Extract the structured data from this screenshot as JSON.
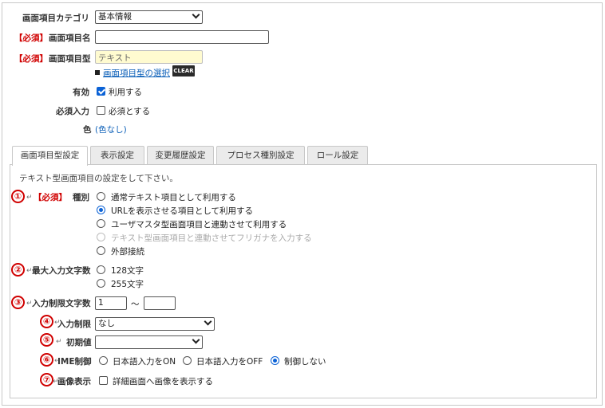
{
  "form": {
    "category_label": "画面項目カテゴリ",
    "category_value": "基本情報",
    "required_tag": "【必須】",
    "name_label": "画面項目名",
    "name_value": "",
    "type_label": "画面項目型",
    "type_value": "テキスト",
    "type_select_link": "画面項目型の選択",
    "clear_button": "CLEAR",
    "enabled_label": "有効",
    "enabled_checkbox_label": "利用する",
    "enabled_checked": true,
    "required_input_label": "必須入力",
    "required_checkbox_label": "必須とする",
    "required_checked": false,
    "color_label": "色",
    "color_value": "(色なし)"
  },
  "tabs": [
    {
      "label": "画面項目型設定",
      "active": true
    },
    {
      "label": "表示設定",
      "active": false
    },
    {
      "label": "変更履歴設定",
      "active": false
    },
    {
      "label": "プロセス種別設定",
      "active": false
    },
    {
      "label": "ロール設定",
      "active": false
    }
  ],
  "panel": {
    "intro": "テキスト型画面項目の設定をして下さい。",
    "kind": {
      "marker": "①",
      "label": "種別",
      "options": [
        {
          "label": "通常テキスト項目として利用する",
          "selected": false,
          "disabled": false
        },
        {
          "label": "URLを表示させる項目として利用する",
          "selected": true,
          "disabled": false
        },
        {
          "label": "ユーザマスタ型画面項目と連動させて利用する",
          "selected": false,
          "disabled": false
        },
        {
          "label": "テキスト型画面項目と連動させてフリガナを入力する",
          "selected": false,
          "disabled": true
        },
        {
          "label": "外部接続",
          "selected": false,
          "disabled": false
        }
      ]
    },
    "maxlen": {
      "marker": "②",
      "label": "最大入力文字数",
      "options": [
        {
          "label": "128文字",
          "selected": false
        },
        {
          "label": "255文字",
          "selected": false
        }
      ]
    },
    "limitlen": {
      "marker": "③",
      "label": "入力制限文字数",
      "min_value": "1",
      "tilde": "～",
      "max_value": ""
    },
    "restriction": {
      "marker": "④",
      "label": "入力制限",
      "value": "なし"
    },
    "initial": {
      "marker": "⑤",
      "label": "初期値",
      "value": ""
    },
    "ime": {
      "marker": "⑥",
      "label": "IME制御",
      "options": [
        {
          "label": "日本語入力をON",
          "selected": false
        },
        {
          "label": "日本語入力をOFF",
          "selected": false
        },
        {
          "label": "制御しない",
          "selected": true
        }
      ]
    },
    "image": {
      "marker": "⑦",
      "label": "画像表示",
      "checkbox_label": "詳細画面へ画像を表示する",
      "checked": false
    }
  },
  "icons": {
    "return": "return-arrow-icon",
    "chevron": "chevron-down-icon",
    "bullet": "square-bullet-icon"
  },
  "colors": {
    "required": "#d00000",
    "link": "#0b5fb8",
    "accent": "#0b62d6",
    "type_field_bg": "#fffbd0"
  }
}
